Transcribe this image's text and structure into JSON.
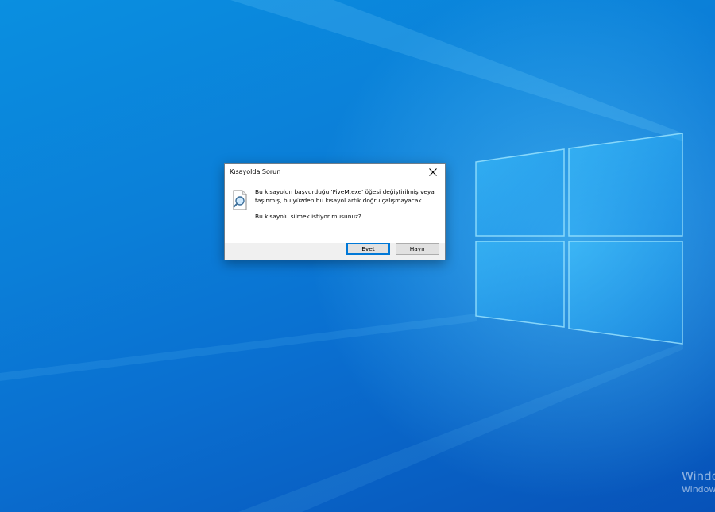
{
  "desktop": {
    "watermark_line1": "Windo",
    "watermark_line2": "Window"
  },
  "dialog": {
    "title": "Kısayolda Sorun",
    "icon": "shortcut-search-icon",
    "message": "Bu kısayolun başvurduğu 'FiveM.exe' öğesi değiştirilmiş veya taşınmış, bu yüzden bu kısayol artık doğru çalışmayacak.",
    "question": "Bu kısayolu silmek istiyor musunuz?",
    "yes_label": "Evet",
    "no_label": "Hayır",
    "close_icon": "close-icon"
  },
  "colors": {
    "accent": "#0078d7",
    "desktop_bg": "#0b7fd8"
  }
}
